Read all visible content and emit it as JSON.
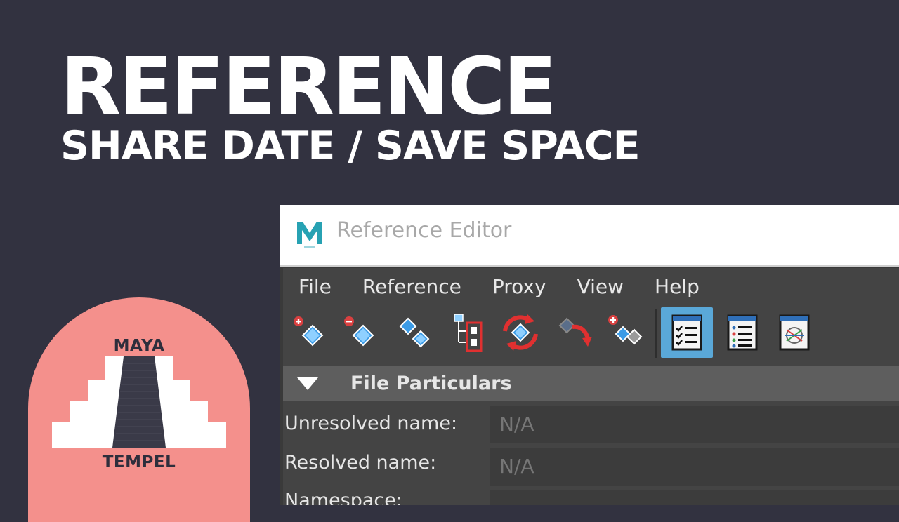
{
  "headline": "REFERENCE",
  "subline": "SHARE DATE / SAVE SPACE",
  "logo": {
    "top_text": "MAYA",
    "bottom_text": "TEMPEL"
  },
  "window": {
    "title": "Reference Editor",
    "app_icon_letter": "M",
    "menu": [
      "File",
      "Reference",
      "Proxy",
      "View",
      "Help"
    ],
    "toolbar_icons": [
      "create-reference-icon",
      "remove-reference-icon",
      "duplicate-reference-icon",
      "group-reference-icon",
      "reload-reference-icon",
      "replace-reference-icon",
      "import-reference-icon",
      "list-checked-view-icon",
      "list-bullets-view-icon",
      "graph-view-icon"
    ],
    "section": {
      "title": "File Particulars",
      "expanded": true
    },
    "fields": [
      {
        "label": "Unresolved name:",
        "value": "N/A"
      },
      {
        "label": "Resolved name:",
        "value": "N/A"
      },
      {
        "label": "Namespace:",
        "value": ""
      }
    ]
  },
  "colors": {
    "background": "#323240",
    "logo": "#f4908c",
    "accent_blue": "#5aa8d8",
    "maya_teal": "#27a2b3"
  }
}
